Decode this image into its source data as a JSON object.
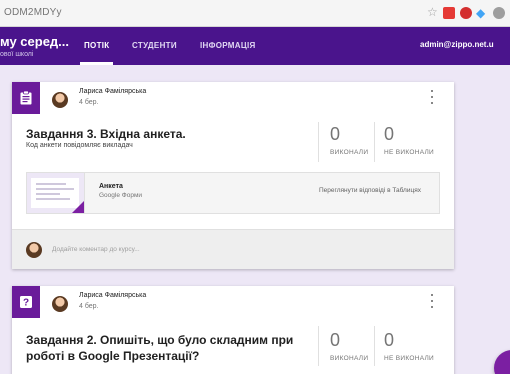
{
  "browser": {
    "url_fragment": "ODM2MDYy",
    "extension_icons": [
      "star-icon",
      "extension-icon",
      "adblock-icon",
      "diamond-icon",
      "profile-icon"
    ]
  },
  "appbar": {
    "class_name": "му серед...",
    "class_subtitle": "ової школі",
    "tabs": [
      {
        "label": "ПОТІК",
        "active": true
      },
      {
        "label": "СТУДЕНТИ",
        "active": false
      },
      {
        "label": "ІНФОРМАЦІЯ",
        "active": false
      }
    ],
    "account": "admin@zippo.net.u"
  },
  "posts": [
    {
      "type_icon": "assignment-icon",
      "author": "Лариса Фамілярська",
      "date": "4 бер.",
      "title": "Завдання 3. Вхідна анкета.",
      "note": "Код анкети повідомляє викладач",
      "done_count": "0",
      "done_label": "ВИКОНАЛИ",
      "not_done_count": "0",
      "not_done_label": "НЕ ВИКОНАЛИ",
      "attachment": {
        "title": "Анкета",
        "subtitle": "Google Форми",
        "link": "Переглянути відповіді в Таблицях"
      },
      "comment_placeholder": "Додайте коментар до курсу..."
    },
    {
      "type_icon": "question-icon",
      "author": "Лариса Фамілярська",
      "date": "4 бер.",
      "title": "Завдання 2. Опишіть, що було складним при роботі в Google Презентації?",
      "done_count": "0",
      "done_label": "ВИКОНАЛИ",
      "not_done_count": "0",
      "not_done_label": "НЕ ВИКОНАЛИ"
    }
  ],
  "colors": {
    "appbar": "#4a148c",
    "accent": "#6a1b9a",
    "background": "#ede7f6"
  }
}
